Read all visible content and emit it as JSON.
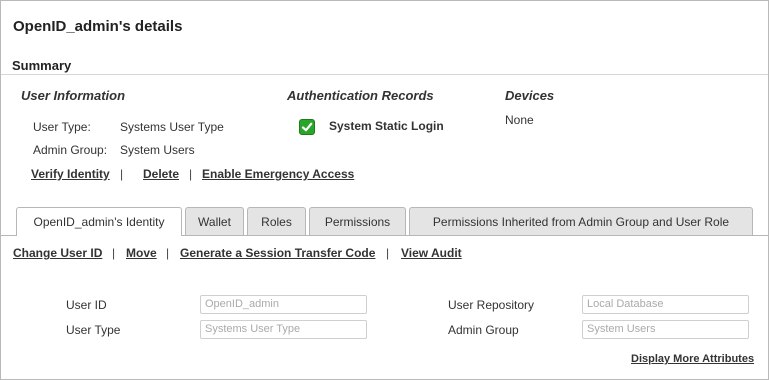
{
  "page": {
    "title": "OpenID_admin's details"
  },
  "summary": {
    "title": "Summary",
    "user_information": {
      "heading": "User Information",
      "user_type_label": "User Type:",
      "user_type_value": "Systems User Type",
      "admin_group_label": "Admin Group:",
      "admin_group_value": "System Users"
    },
    "authentication_records": {
      "heading": "Authentication Records",
      "record": "System Static Login",
      "record_icon": "green-check-icon",
      "record_color": "#2aa52a"
    },
    "devices": {
      "heading": "Devices",
      "value": "None"
    },
    "actions": {
      "verify": "Verify Identity",
      "delete": "Delete",
      "emergency": "Enable Emergency Access",
      "sep": "|"
    }
  },
  "tabs": [
    {
      "label": "OpenID_admin's Identity",
      "active": true
    },
    {
      "label": "Wallet",
      "active": false
    },
    {
      "label": "Roles",
      "active": false
    },
    {
      "label": "Permissions",
      "active": false
    },
    {
      "label": "Permissions Inherited from Admin Group and User Role",
      "active": false
    }
  ],
  "identity": {
    "actions": {
      "change_user_id": "Change User ID",
      "move": "Move",
      "generate_code": "Generate a Session Transfer Code",
      "view_audit": "View Audit",
      "sep": "|"
    },
    "fields": {
      "user_id_label": "User ID",
      "user_id_value": "OpenID_admin",
      "user_type_label": "User Type",
      "user_type_value": "Systems User Type",
      "user_repository_label": "User Repository",
      "user_repository_value": "Local Database",
      "admin_group_label": "Admin Group",
      "admin_group_value": "System Users"
    },
    "display_more": "Display More Attributes"
  }
}
